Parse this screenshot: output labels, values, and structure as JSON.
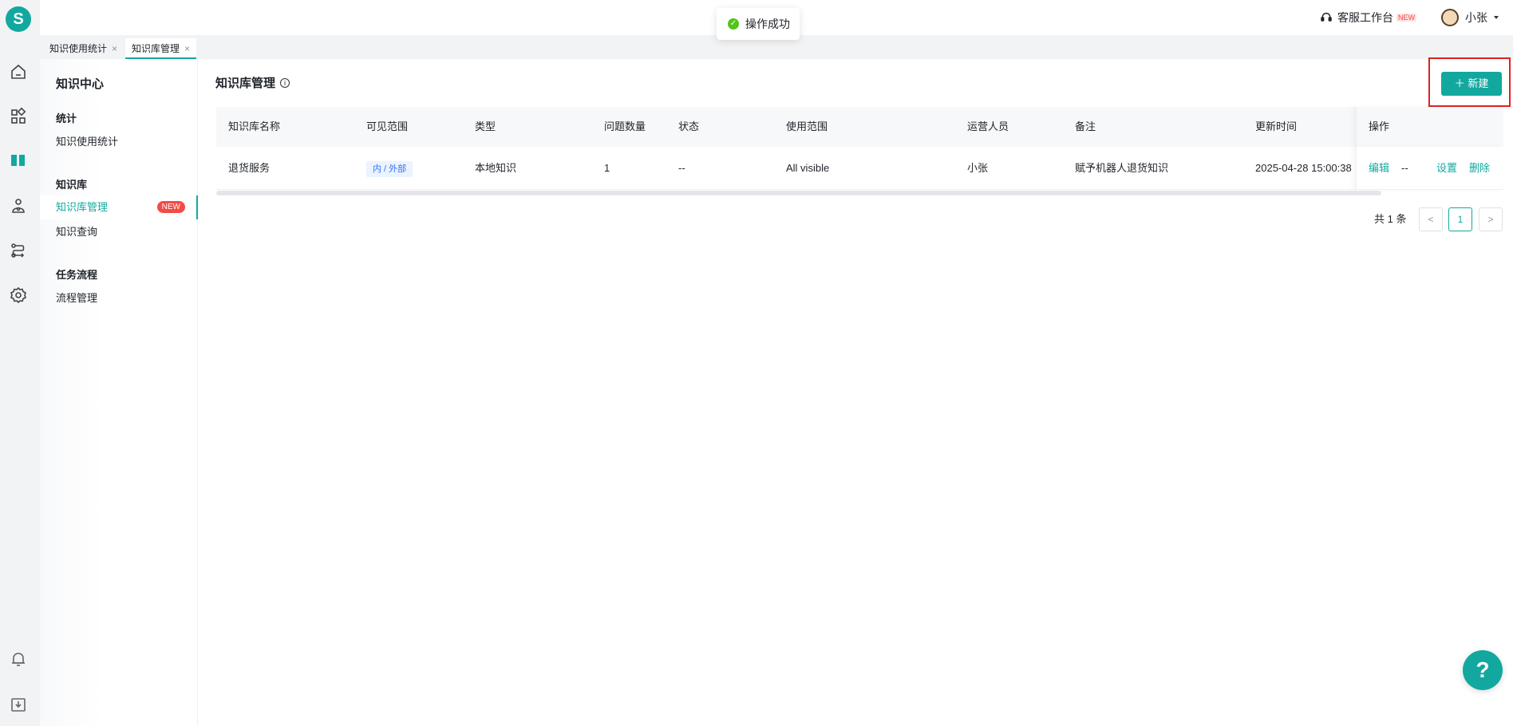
{
  "brand": {
    "logo_letter": "S"
  },
  "toast": {
    "message": "操作成功"
  },
  "header": {
    "cs_workbench": "客服工作台",
    "cs_new_badge": "NEW",
    "user_name": "小张"
  },
  "tabs": [
    {
      "label": "知识使用统计",
      "close": "×"
    },
    {
      "label": "知识库管理",
      "close": "×"
    }
  ],
  "sidebar": {
    "title": "知识中心",
    "groups": [
      {
        "label": "统计",
        "items": [
          {
            "label": "知识使用统计"
          }
        ]
      },
      {
        "label": "知识库",
        "items": [
          {
            "label": "知识库管理",
            "badge": "NEW"
          },
          {
            "label": "知识查询"
          }
        ]
      },
      {
        "label": "任务流程",
        "items": [
          {
            "label": "流程管理"
          }
        ]
      }
    ]
  },
  "main": {
    "title": "知识库管理",
    "new_button": "新建",
    "columns": [
      "知识库名称",
      "可见范围",
      "类型",
      "问题数量",
      "状态",
      "使用范围",
      "运营人员",
      "备注",
      "更新时间",
      "操作"
    ],
    "rows": [
      {
        "name": "退货服务",
        "visibility": "内 / 外部",
        "type": "本地知识",
        "question_count": "1",
        "status": "--",
        "usage_scope": "All visible",
        "operator": "小张",
        "remark": "赋予机器人退货知识",
        "updated_at": "2025-04-28 15:00:38",
        "actions": {
          "edit": "编辑",
          "dash": "--",
          "settings": "设置",
          "delete": "删除"
        }
      }
    ],
    "pagination": {
      "total": "共 1 条",
      "prev": "<",
      "current": "1",
      "next": ">"
    }
  },
  "help_button": "?",
  "colors": {
    "accent": "#12a89f",
    "danger": "#f54a45",
    "highlight_box": "#e02020"
  }
}
